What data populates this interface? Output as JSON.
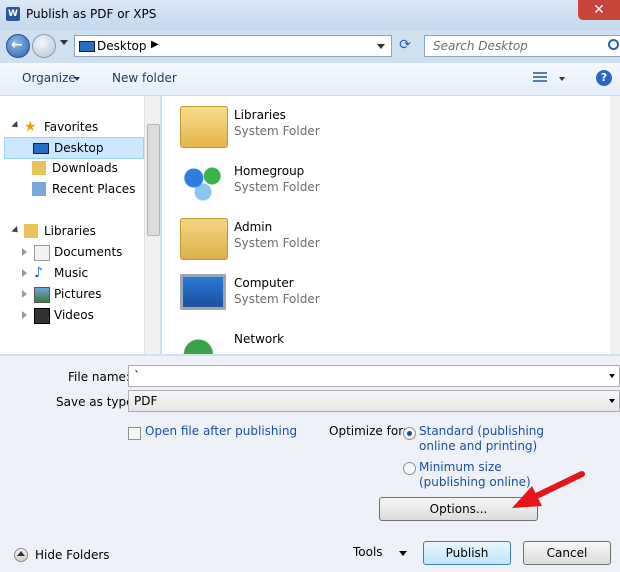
{
  "window": {
    "title": "Publish as PDF or XPS",
    "app_icon": "W"
  },
  "nav": {
    "address": "Desktop",
    "search_placeholder": "Search Desktop"
  },
  "toolbar": {
    "organize": "Organize",
    "new_folder": "New folder"
  },
  "sidebar": {
    "groups": [
      {
        "label": "Favorites",
        "items": [
          "Desktop",
          "Downloads",
          "Recent Places"
        ]
      },
      {
        "label": "Libraries",
        "items": [
          "Documents",
          "Music",
          "Pictures",
          "Videos"
        ]
      }
    ]
  },
  "files": [
    {
      "name": "Libraries",
      "type": "System Folder"
    },
    {
      "name": "Homegroup",
      "type": "System Folder"
    },
    {
      "name": "Admin",
      "type": "System Folder"
    },
    {
      "name": "Computer",
      "type": "System Folder"
    },
    {
      "name": "Network",
      "type": ""
    }
  ],
  "form": {
    "filename_label": "File name:",
    "filename_value": "`",
    "savetype_label": "Save as type:",
    "savetype_value": "PDF",
    "open_after": "Open file after publishing",
    "optimize_label": "Optimize for:",
    "opt_standard_1": "Standard (publishing",
    "opt_standard_2": "online and printing)",
    "opt_min_1": "Minimum size",
    "opt_min_2": "(publishing online)",
    "options_btn": "Options..."
  },
  "footer": {
    "hide_folders": "Hide Folders",
    "tools": "Tools",
    "publish": "Publish",
    "cancel": "Cancel"
  },
  "colors": {
    "accent_red_arrow": "#e8141b",
    "link_blue": "#1c4e9f"
  }
}
